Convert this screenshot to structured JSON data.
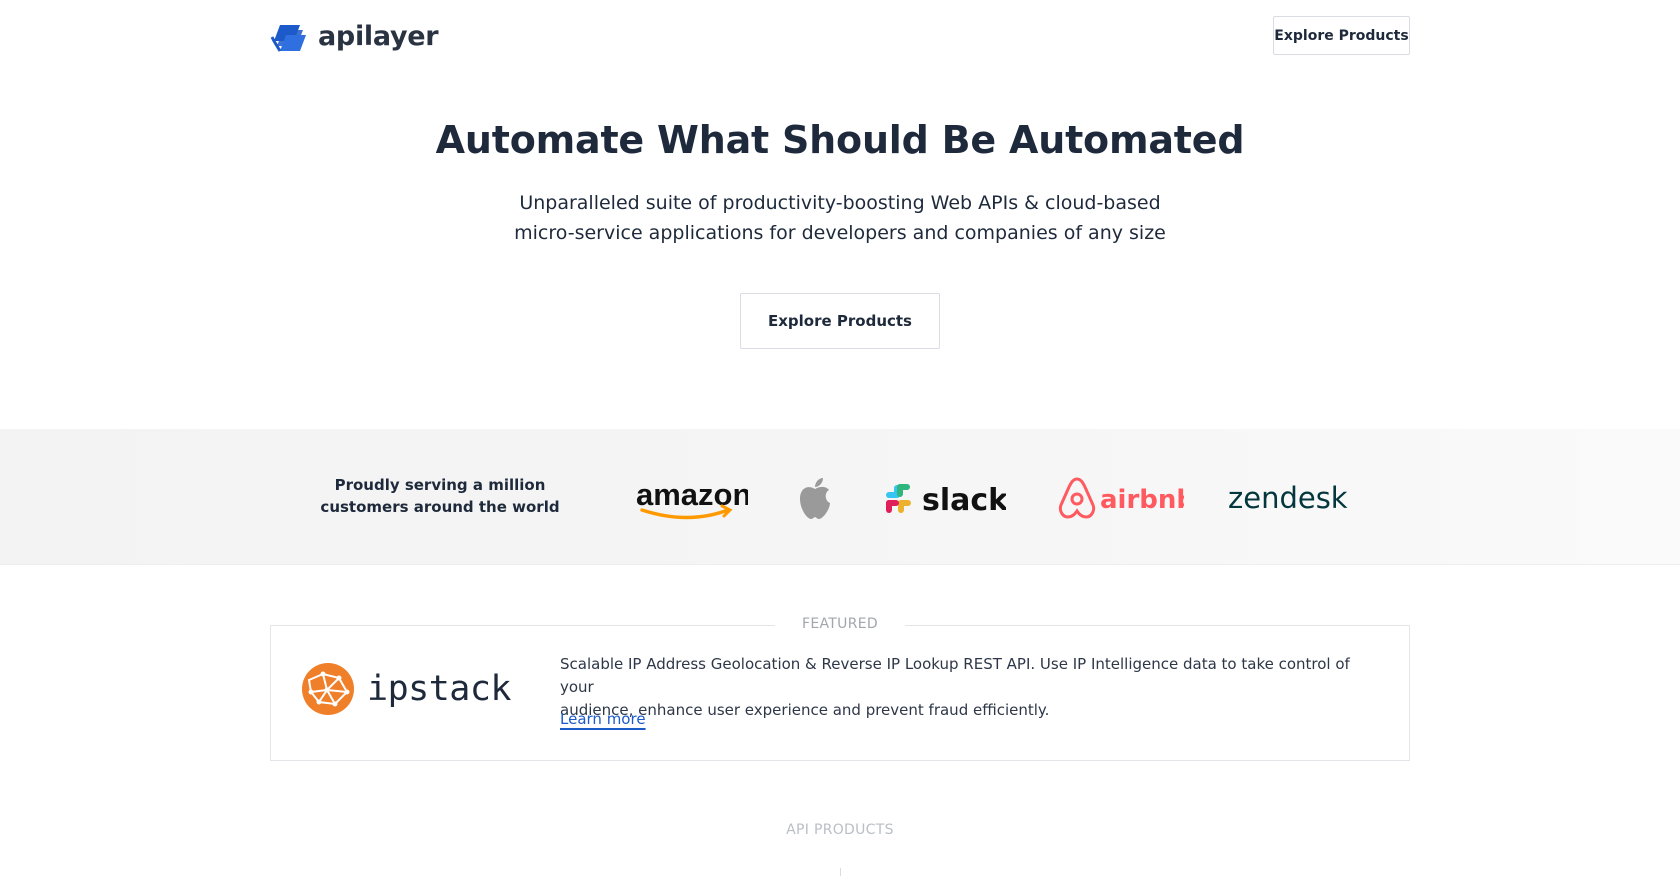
{
  "header": {
    "logo_text": "apilayer",
    "cta_label": "Explore Products"
  },
  "hero": {
    "title": "Automate What Should Be Automated",
    "subtitle_lines": [
      "Unparalleled suite of productivity-boosting Web APIs & cloud-based",
      "micro-service applications for developers and companies of any size"
    ],
    "cta_label": "Explore Products"
  },
  "customers": {
    "text_lines": [
      "Proudly serving a million",
      "customers around the world"
    ],
    "brands": [
      "amazon",
      "apple",
      "slack",
      "airbnb",
      "zendesk"
    ]
  },
  "featured": {
    "label": "FEATURED",
    "product_name": "ipstack",
    "description_lines": [
      "Scalable IP Address Geolocation & Reverse IP Lookup REST API. Use IP Intelligence data to take control of your",
      "audience, enhance user experience and prevent fraud efficiently."
    ],
    "link_label": "Learn more"
  },
  "api_products": {
    "label": "API PRODUCTS"
  },
  "colors": {
    "brand_blue": "#1c59c9",
    "ipstack_orange": "#f07f2a",
    "airbnb_red": "#ff5a5f",
    "zendesk_green": "#03363d",
    "amazon_orange": "#ff9900"
  }
}
